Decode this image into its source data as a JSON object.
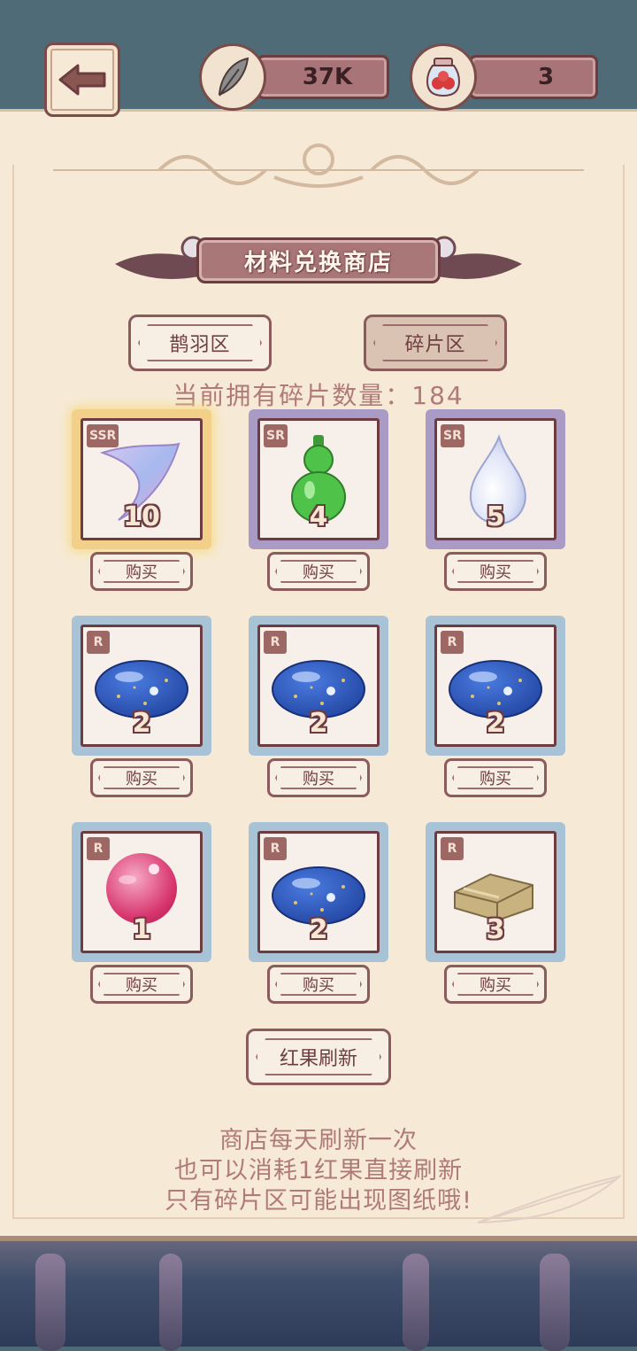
{
  "resources": {
    "feather_amount": "37K",
    "berry_amount": "3"
  },
  "shop": {
    "title": "材料兑换商店",
    "tabs": [
      {
        "label": "鹊羽区",
        "selected": false
      },
      {
        "label": "碎片区",
        "selected": true
      }
    ],
    "fragment_count_line": "当前拥有碎片数量：184",
    "buy_label": "购买",
    "items": [
      {
        "rarity": "SSR",
        "qty": "10",
        "icon": "crescent-feather-icon",
        "frame_color": "#f3d08a"
      },
      {
        "rarity": "SR",
        "qty": "4",
        "icon": "green-gourd-icon",
        "frame_color": "#a99bc6"
      },
      {
        "rarity": "SR",
        "qty": "5",
        "icon": "water-drop-icon",
        "frame_color": "#a99bc6"
      },
      {
        "rarity": "R",
        "qty": "2",
        "icon": "blue-stone-icon",
        "frame_color": "#a9c3d6"
      },
      {
        "rarity": "R",
        "qty": "2",
        "icon": "blue-stone-icon",
        "frame_color": "#a9c3d6"
      },
      {
        "rarity": "R",
        "qty": "2",
        "icon": "blue-stone-icon",
        "frame_color": "#a9c3d6"
      },
      {
        "rarity": "R",
        "qty": "1",
        "icon": "pink-pearl-icon",
        "frame_color": "#a9c3d6"
      },
      {
        "rarity": "R",
        "qty": "2",
        "icon": "blue-stone-icon",
        "frame_color": "#a9c3d6"
      },
      {
        "rarity": "R",
        "qty": "3",
        "icon": "folded-cloth-icon",
        "frame_color": "#a9c3d6"
      }
    ],
    "refresh_label": "红果刷新",
    "info_lines": [
      "商店每天刷新一次",
      "也可以消耗1红果直接刷新",
      "只有碎片区可能出现图纸哦!"
    ]
  }
}
